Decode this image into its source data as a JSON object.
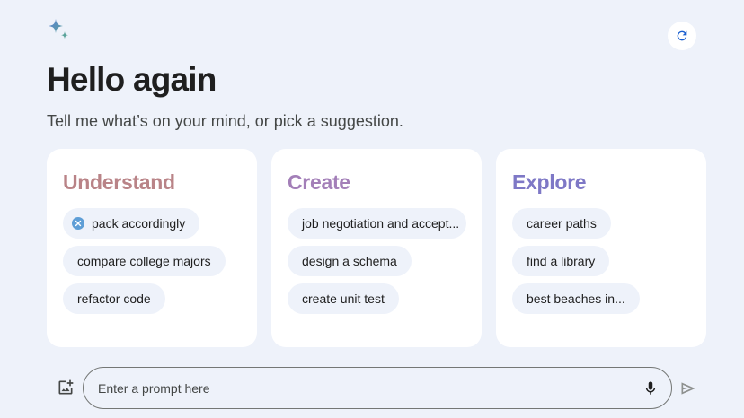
{
  "header": {
    "logo_icon": "sparkle-icon",
    "refresh_icon": "refresh-icon"
  },
  "greeting": "Hello again",
  "subtitle": "Tell me what’s on your mind, or pick a suggestion.",
  "cards": [
    {
      "title": "Understand",
      "color": "#b98387",
      "chips": [
        "pack accordingly",
        "compare college majors",
        "refactor code"
      ]
    },
    {
      "title": "Create",
      "color": "#a37fb8",
      "chips": [
        "job negotiation and accept...",
        "design a schema",
        "create unit test"
      ]
    },
    {
      "title": "Explore",
      "color": "#7e78c6",
      "chips": [
        "career paths",
        "find a library",
        "best beaches in..."
      ]
    }
  ],
  "prompt": {
    "placeholder": "Enter a prompt here",
    "value": "",
    "image_icon": "add-image-icon",
    "mic_icon": "microphone-icon",
    "send_icon": "send-icon"
  },
  "colors": {
    "background": "#eef2fa",
    "card": "#ffffff",
    "chip_icon": "#5e9ed6"
  }
}
